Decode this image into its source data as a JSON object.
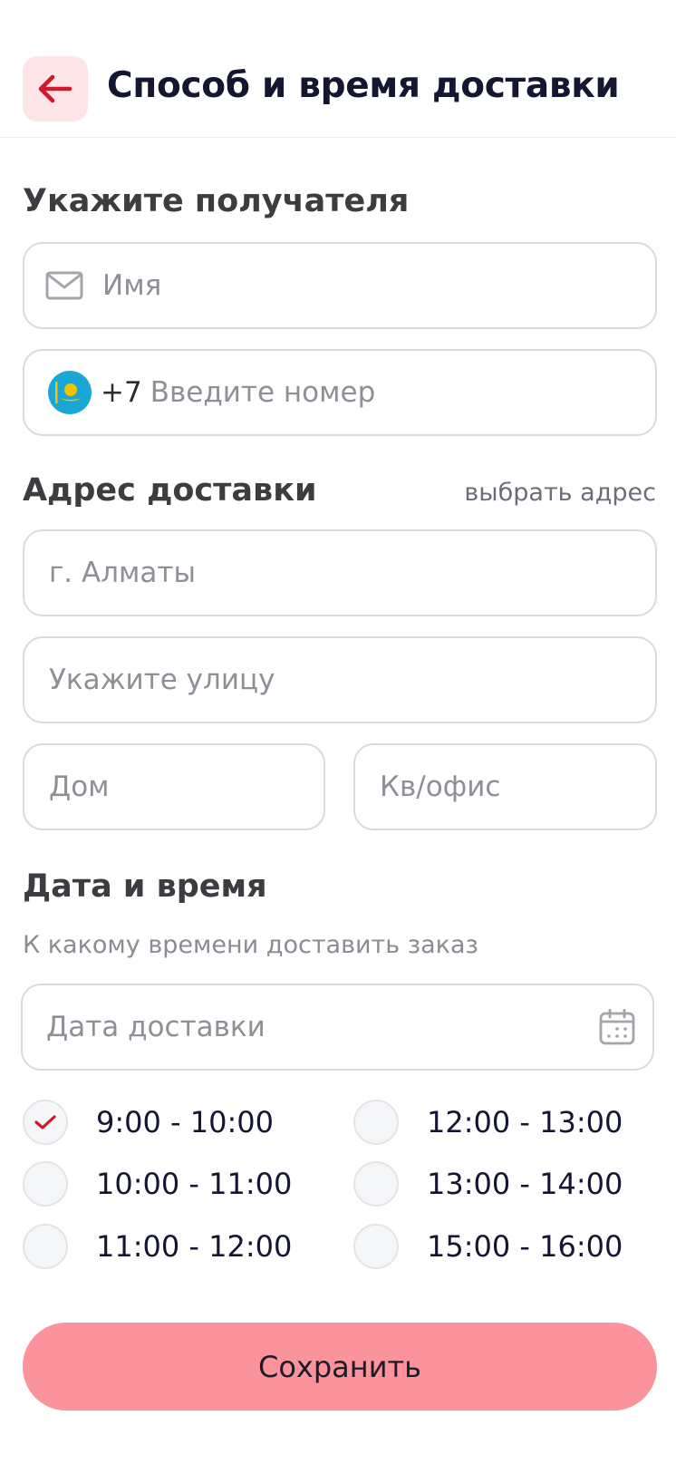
{
  "header": {
    "title": "Способ и время доставки",
    "back_icon": "arrow-left-icon"
  },
  "recipient": {
    "title": "Укажите получателя",
    "name_placeholder": "Имя",
    "phone_prefix": "+7",
    "phone_placeholder": "Введите номер",
    "country_flag": "kazakhstan-flag-icon"
  },
  "address": {
    "title": "Адрес доставки",
    "choose_link": "выбрать адрес",
    "city_placeholder": "г. Алматы",
    "street_placeholder": "Укажите улицу",
    "house_placeholder": "Дом",
    "apartment_placeholder": "Кв/офис"
  },
  "datetime": {
    "title": "Дата и время",
    "subtitle": "К какому времени доставить заказ",
    "date_placeholder": "Дата доставки",
    "calendar_icon": "calendar-icon",
    "slots": [
      {
        "label": "9:00 - 10:00",
        "selected": true
      },
      {
        "label": "12:00 - 13:00",
        "selected": false
      },
      {
        "label": "10:00 - 11:00",
        "selected": false
      },
      {
        "label": "13:00 - 14:00",
        "selected": false
      },
      {
        "label": "11:00 - 12:00",
        "selected": false
      },
      {
        "label": "15:00 - 16:00",
        "selected": false
      }
    ]
  },
  "footer": {
    "save_label": "Сохранить"
  },
  "colors": {
    "accent": "#d0172b",
    "back_button_bg": "#fde4e6",
    "save_button_bg": "#fb939c",
    "kz_flag_blue": "#1ba7d6",
    "kz_flag_gold": "#f4c300"
  }
}
